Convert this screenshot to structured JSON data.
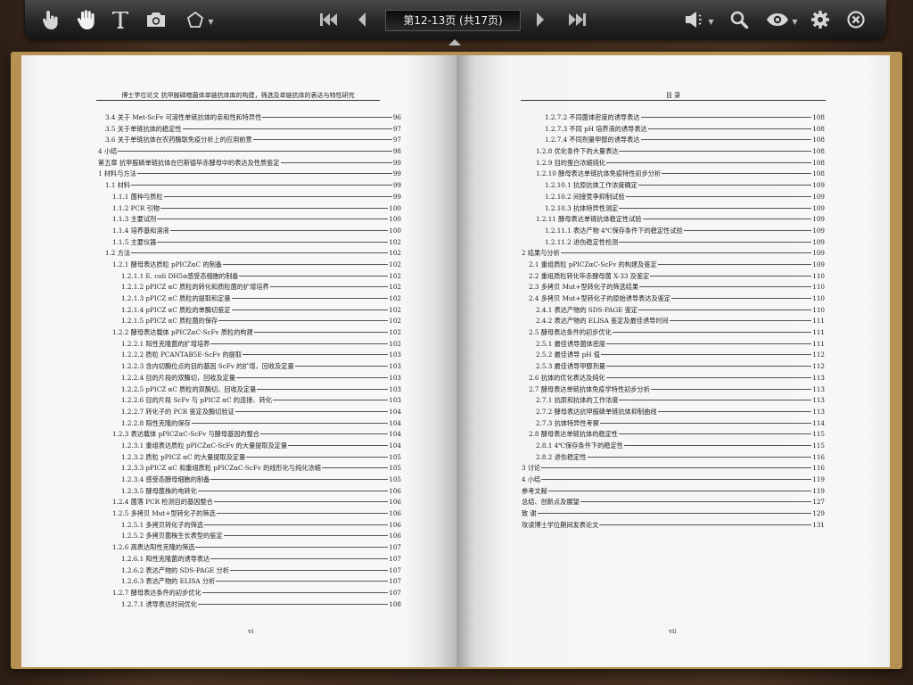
{
  "toolbar": {
    "tools": [
      {
        "name": "pointer-icon"
      },
      {
        "name": "hand-icon"
      },
      {
        "name": "text-tool-icon"
      },
      {
        "name": "camera-icon"
      },
      {
        "name": "pentagon-icon"
      }
    ],
    "page_indicator": "第12-13页 (共17页)",
    "right_tools": [
      {
        "name": "volume-icon"
      },
      {
        "name": "search-icon"
      },
      {
        "name": "eye-icon"
      },
      {
        "name": "gear-icon"
      },
      {
        "name": "close-icon"
      }
    ]
  },
  "left_page": {
    "header": "博士学位论文 抗甲胺磷噬菌体单链抗体库的构建，筛选及单链抗体的表达与特性研究",
    "page_label": "vi",
    "entries": [
      {
        "indent": 1,
        "text": "3.4 关于 Met-ScFv 可溶性单链抗体的亲和性和特异性",
        "page": "96"
      },
      {
        "indent": 1,
        "text": "3.5 关于单链抗体的稳定性",
        "page": "97"
      },
      {
        "indent": 1,
        "text": "3.6 关于单链抗体在农药酶联免疫分析上的应用前景",
        "page": "97"
      },
      {
        "indent": 0,
        "text": "4 小结",
        "page": "98"
      },
      {
        "indent": 0,
        "text": "第五章 抗甲胺磷单链抗体在巴斯德毕赤酵母中的表达及性质鉴定",
        "page": "99"
      },
      {
        "indent": 0,
        "text": "1 材料与方法",
        "page": "99"
      },
      {
        "indent": 1,
        "text": "1.1 材料",
        "page": "99"
      },
      {
        "indent": 2,
        "text": "1.1.1 菌种与质粒",
        "page": "99"
      },
      {
        "indent": 2,
        "text": "1.1.2 PCR 引物",
        "page": "100"
      },
      {
        "indent": 2,
        "text": "1.1.3 主要试剂",
        "page": "100"
      },
      {
        "indent": 2,
        "text": "1.1.4 培养基和溶液",
        "page": "100"
      },
      {
        "indent": 2,
        "text": "1.1.5 主要仪器",
        "page": "102"
      },
      {
        "indent": 1,
        "text": "1.2 方法",
        "page": "102"
      },
      {
        "indent": 2,
        "text": "1.2.1 酵母表达质粒 pPICZαC 的制备",
        "page": "102"
      },
      {
        "indent": 3,
        "text": "1.2.1.1 E. coli DH5α感受态细胞的制备",
        "page": "102"
      },
      {
        "indent": 3,
        "text": "1.2.1.2 pPICZ αC 质粒的转化和质粒菌的扩增培养",
        "page": "102"
      },
      {
        "indent": 3,
        "text": "1.2.1.3 pPICZ αC 质粒的提取和定量",
        "page": "102"
      },
      {
        "indent": 3,
        "text": "1.2.1.4 pPICZ αC 质粒的单酶切鉴定",
        "page": "102"
      },
      {
        "indent": 3,
        "text": "1.2.1.5 pPICZ αC 质粒菌的保存",
        "page": "102"
      },
      {
        "indent": 2,
        "text": "1.2.2 酵母表达载体 pPICZαC-ScFv 质粒的构建",
        "page": "102"
      },
      {
        "indent": 3,
        "text": "1.2.2.1 阳性克隆菌的扩增培养",
        "page": "102"
      },
      {
        "indent": 3,
        "text": "1.2.2.2 质粒 PCANTAB5E-ScFv 的提取",
        "page": "103"
      },
      {
        "indent": 3,
        "text": "1.2.2.3 含内切酶位点的目的基因 ScFv 的扩增，回收及定量",
        "page": "103"
      },
      {
        "indent": 3,
        "text": "1.2.2.4 目的片段的双酶切，回收及定量",
        "page": "103"
      },
      {
        "indent": 3,
        "text": "1.2.2.5 pPICZ αC 质粒的双酶切，回收及定量",
        "page": "103"
      },
      {
        "indent": 3,
        "text": "1.2.2.6 目的片段 ScFv 与 pPICZ αC 的连接、转化",
        "page": "103"
      },
      {
        "indent": 3,
        "text": "1.2.2.7 转化子的 PCR 鉴定及酶切验证",
        "page": "104"
      },
      {
        "indent": 3,
        "text": "1.2.2.8 阳性克隆的保存",
        "page": "104"
      },
      {
        "indent": 2,
        "text": "1.2.3 表达载体 pPICZαC-ScFv 与酵母基因的整合",
        "page": "104"
      },
      {
        "indent": 3,
        "text": "1.2.3.1 重组表达质粒 pPICZαC-ScFv 的大量提取及定量",
        "page": "104"
      },
      {
        "indent": 3,
        "text": "1.2.3.2 质粒 pPICZ αC 的大量提取及定量",
        "page": "105"
      },
      {
        "indent": 3,
        "text": "1.2.3.3 pPICZ αC 和重组质粒 pPICZαC-ScFv 的线形化与纯化浓缩",
        "page": "105"
      },
      {
        "indent": 3,
        "text": "1.2.3.4 感受态酵母细胞的制备",
        "page": "105"
      },
      {
        "indent": 3,
        "text": "1.2.3.5 酵母菌株的电转化",
        "page": "106"
      },
      {
        "indent": 2,
        "text": "1.2.4 菌落 PCR 检测目的基因整合",
        "page": "106"
      },
      {
        "indent": 2,
        "text": "1.2.5 多拷贝 Mut+型转化子的筛选",
        "page": "106"
      },
      {
        "indent": 3,
        "text": "1.2.5.1 多拷贝转化子的筛选",
        "page": "106"
      },
      {
        "indent": 3,
        "text": "1.2.5.2 多拷贝菌株生长表型的鉴定",
        "page": "106"
      },
      {
        "indent": 2,
        "text": "1.2.6 高表达阳性克隆的筛选",
        "page": "107"
      },
      {
        "indent": 3,
        "text": "1.2.6.1 阳性克隆菌的诱导表达",
        "page": "107"
      },
      {
        "indent": 3,
        "text": "1.2.6.2 表达产物的 SDS-PAGE 分析",
        "page": "107"
      },
      {
        "indent": 3,
        "text": "1.2.6.3 表达产物的 ELISA 分析",
        "page": "107"
      },
      {
        "indent": 2,
        "text": "1.2.7 酵母表达条件的初步优化",
        "page": "107"
      },
      {
        "indent": 3,
        "text": "1.2.7.1 诱导表达时间优化",
        "page": "108"
      }
    ]
  },
  "right_page": {
    "header": "目    录",
    "page_label": "vii",
    "entries": [
      {
        "indent": 3,
        "text": "1.2.7.2 不同菌体密度的诱导表达",
        "page": "108"
      },
      {
        "indent": 3,
        "text": "1.2.7.3 不同 pH 培养液的诱导表达",
        "page": "108"
      },
      {
        "indent": 3,
        "text": "1.2.7.4 不同剂量甲醇的诱导表达",
        "page": "108"
      },
      {
        "indent": 2,
        "text": "1.2.8 优化条件下的大量表达",
        "page": "108"
      },
      {
        "indent": 2,
        "text": "1.2.9 目的蛋白浓缩纯化",
        "page": "108"
      },
      {
        "indent": 2,
        "text": "1.2.10 酵母表达单链抗体免疫特性初步分析",
        "page": "108"
      },
      {
        "indent": 3,
        "text": "1.2.10.1 抗原抗体工作浓度确定",
        "page": "109"
      },
      {
        "indent": 3,
        "text": "1.2.10.2 间接竞争抑制试验",
        "page": "109"
      },
      {
        "indent": 3,
        "text": "1.2.10.3 抗体特异性测定",
        "page": "109"
      },
      {
        "indent": 2,
        "text": "1.2.11 酵母表达单链抗体稳定性试验",
        "page": "109"
      },
      {
        "indent": 3,
        "text": "1.2.11.1 表达产物 4℃保存条件下的稳定性试验",
        "page": "109"
      },
      {
        "indent": 3,
        "text": "1.2.11.2 进伤稳定性检测",
        "page": "109"
      },
      {
        "indent": 0,
        "text": "2 结果与分析",
        "page": "109"
      },
      {
        "indent": 1,
        "text": "2.1 重组质粒 pPICZαC-ScFv 的构建及鉴定",
        "page": "109"
      },
      {
        "indent": 1,
        "text": "2.2 重组质粒转化毕赤酵母菌 X-33 及鉴定",
        "page": "110"
      },
      {
        "indent": 1,
        "text": "2.3 多拷贝 Mut+型转化子的筛选结果",
        "page": "110"
      },
      {
        "indent": 1,
        "text": "2.4 多拷贝 Mut+型转化子的原始诱导表达及鉴定",
        "page": "110"
      },
      {
        "indent": 2,
        "text": "2.4.1 表达产物的 SDS-PAGE 鉴定",
        "page": "110"
      },
      {
        "indent": 2,
        "text": "2.4.2 表达产物的 ELISA 鉴定及最佳诱导时间",
        "page": "111"
      },
      {
        "indent": 1,
        "text": "2.5 酵母表达条件的初步优化",
        "page": "111"
      },
      {
        "indent": 2,
        "text": "2.5.1 最佳诱导菌体密度",
        "page": "111"
      },
      {
        "indent": 2,
        "text": "2.5.2 最佳诱导 pH 值",
        "page": "112"
      },
      {
        "indent": 2,
        "text": "2.5.3 最佳诱导甲醇剂量",
        "page": "112"
      },
      {
        "indent": 1,
        "text": "2.6 抗体的优化表达及纯化",
        "page": "113"
      },
      {
        "indent": 1,
        "text": "2.7 酵母表达单链抗体免疫学特性初步分析",
        "page": "113"
      },
      {
        "indent": 2,
        "text": "2.7.1 抗原和抗体的工作浓度",
        "page": "113"
      },
      {
        "indent": 2,
        "text": "2.7.2 酵母表达抗甲胺磷单链抗体抑制曲线",
        "page": "113"
      },
      {
        "indent": 2,
        "text": "2.7.3 抗体特异性考察",
        "page": "114"
      },
      {
        "indent": 1,
        "text": "2.8 酵母表达单链抗体的稳定性",
        "page": "115"
      },
      {
        "indent": 2,
        "text": "2.8.1 4℃保存条件下的稳定性",
        "page": "115"
      },
      {
        "indent": 2,
        "text": "2.8.2 进伤稳定性",
        "page": "116"
      },
      {
        "indent": 0,
        "text": "3 讨论",
        "page": "116"
      },
      {
        "indent": 0,
        "text": "4 小结",
        "page": "119"
      },
      {
        "indent": 0,
        "text": "参考文献",
        "page": "119"
      },
      {
        "indent": 0,
        "text": "总结、创新点及展望",
        "page": "127"
      },
      {
        "indent": 0,
        "text": "致    谢",
        "page": "129"
      },
      {
        "indent": 0,
        "text": "攻读博士学位期间发表论文",
        "page": "131"
      }
    ]
  }
}
